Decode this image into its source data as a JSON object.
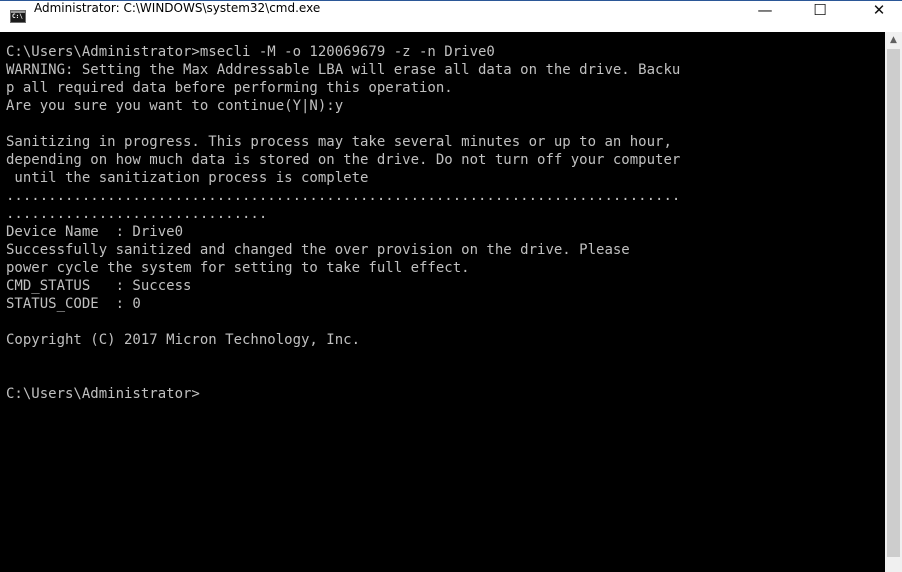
{
  "window": {
    "title": "Administrator: C:\\WINDOWS\\system32\\cmd.exe",
    "icon_label": "C:\\",
    "controls": {
      "minimize": "—",
      "maximize": "☐",
      "close": "✕"
    }
  },
  "console": {
    "lines": [
      "C:\\Users\\Administrator>msecli -M -o 120069679 -z -n Drive0",
      "WARNING: Setting the Max Addressable LBA will erase all data on the drive. Backu",
      "p all required data before performing this operation.",
      "Are you sure you want to continue(Y|N):y",
      "",
      "Sanitizing in progress. This process may take several minutes or up to an hour,",
      "depending on how much data is stored on the drive. Do not turn off your computer",
      " until the sanitization process is complete",
      "................................................................................",
      "...............................",
      "Device Name  : Drive0",
      "Successfully sanitized and changed the over provision on the drive. Please",
      "power cycle the system for setting to take full effect.",
      "CMD_STATUS   : Success",
      "STATUS_CODE  : 0",
      "",
      "Copyright (C) 2017 Micron Technology, Inc.",
      "",
      "",
      "C:\\Users\\Administrator>"
    ]
  },
  "scrollbar": {
    "up_arrow": "▲"
  },
  "colors": {
    "console_background": "#000000",
    "console_text": "#c0c0c0",
    "titlebar_background": "#ffffff",
    "scrollbar_track": "#f0f0f0",
    "scrollbar_thumb": "#cdcdcd"
  }
}
